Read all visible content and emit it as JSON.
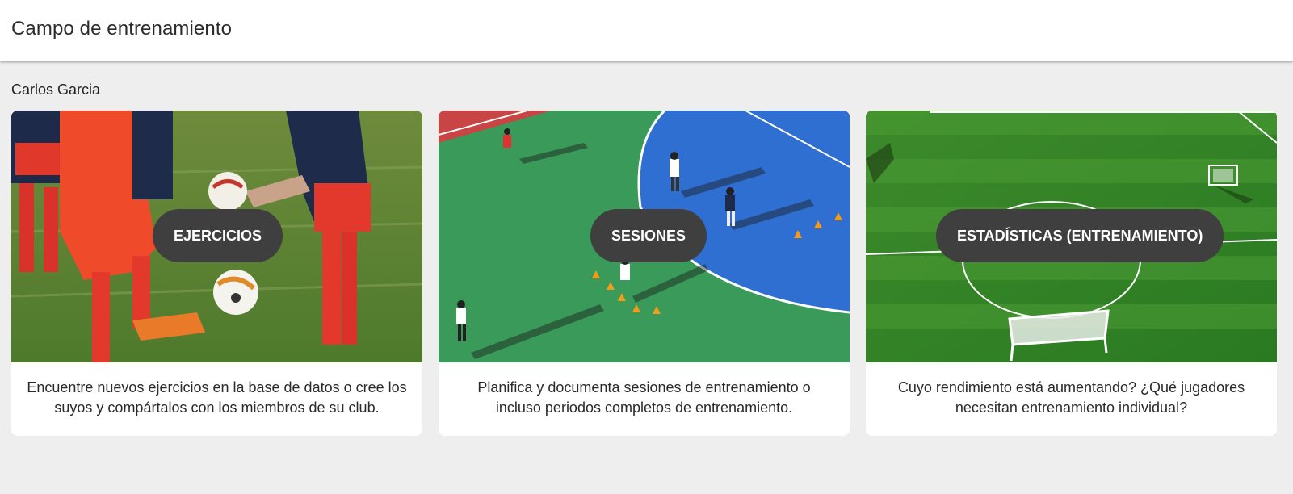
{
  "header": {
    "title": "Campo de entrenamiento"
  },
  "user": {
    "name": "Carlos Garcia"
  },
  "cards": [
    {
      "label": "EJERCICIOS",
      "description": "Encuentre nuevos ejercicios en la base de datos o cree los suyos y compártalos con los miembros de su club."
    },
    {
      "label": "SESIONES",
      "description": "Planifica y documenta sesiones de entrenamiento o incluso periodos completos de entrenamiento."
    },
    {
      "label": "ESTADÍSTICAS (ENTRENAMIENTO)",
      "description": "Cuyo rendimiento está aumentando? ¿Qué jugadores necesitan entrenamiento individual?"
    }
  ],
  "colors": {
    "background": "#eeeeee",
    "card": "#ffffff",
    "pill": "#3f3f3f",
    "pill_text": "#ffffff"
  }
}
